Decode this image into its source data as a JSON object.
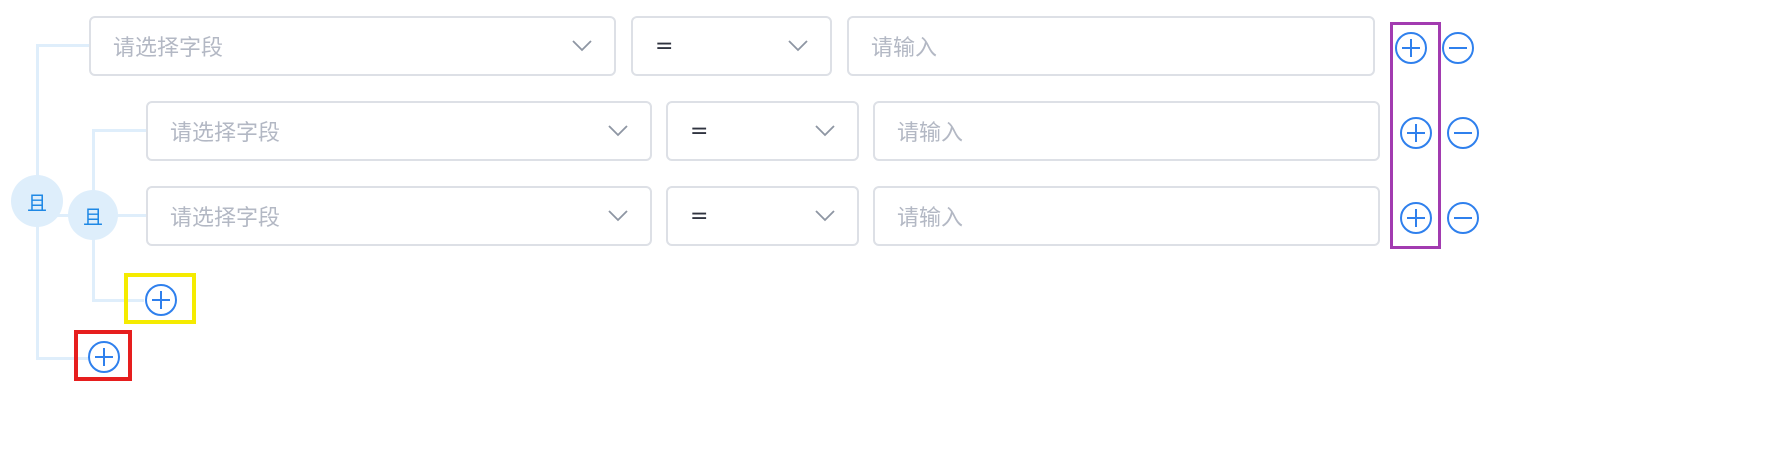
{
  "groups": {
    "outer": {
      "operator": "且"
    },
    "inner": {
      "operator": "且"
    }
  },
  "rows": [
    {
      "field_placeholder": "请选择字段",
      "operator_value": "=",
      "value_placeholder": "请输入"
    },
    {
      "field_placeholder": "请选择字段",
      "operator_value": "=",
      "value_placeholder": "请输入"
    },
    {
      "field_placeholder": "请选择字段",
      "operator_value": "=",
      "value_placeholder": "请输入"
    }
  ],
  "icons": {
    "add": "circle-plus-icon",
    "remove": "circle-minus-icon",
    "dropdown": "chevron-down-icon"
  },
  "colors": {
    "accent": "#2f80ed",
    "tree_line": "#dfeefb",
    "logic_node_bg": "#deeefb",
    "border": "#dde0e6",
    "placeholder": "#b3b8c4",
    "highlight_purple": "#a23bb0",
    "highlight_yellow": "#f5eb00",
    "highlight_red": "#e61e1e"
  }
}
